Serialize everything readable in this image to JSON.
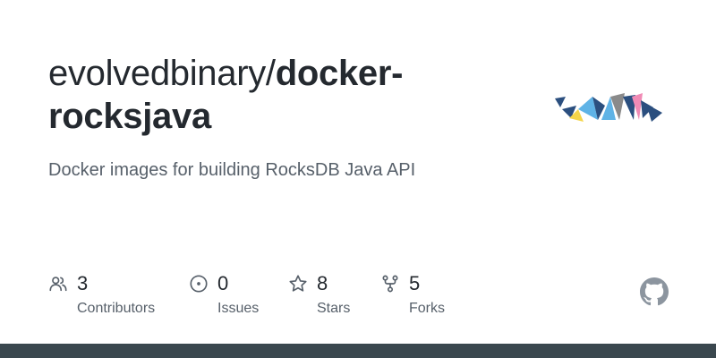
{
  "repo": {
    "owner": "evolvedbinary/",
    "name": "docker-rocksjava",
    "description": "Docker images for building RocksDB Java API"
  },
  "stats": [
    {
      "icon": "people-icon",
      "count": "3",
      "label": "Contributors"
    },
    {
      "icon": "issue-icon",
      "count": "0",
      "label": "Issues"
    },
    {
      "icon": "star-icon",
      "count": "8",
      "label": "Stars"
    },
    {
      "icon": "fork-icon",
      "count": "5",
      "label": "Forks"
    }
  ],
  "colors": {
    "text_primary": "#24292f",
    "text_secondary": "#57606a",
    "icon_gray": "#57606a",
    "github_mark": "#8c959f",
    "footer_bar": "#3a474e",
    "logo_navy": "#2b4f7f",
    "logo_yellow": "#f4d54a",
    "logo_sky": "#5fb3e6",
    "logo_gray": "#8a8a8a",
    "logo_pink": "#f08bb5"
  },
  "icons": {
    "logo": "evolvedbinary-logo",
    "brand": "github-mark-icon"
  }
}
